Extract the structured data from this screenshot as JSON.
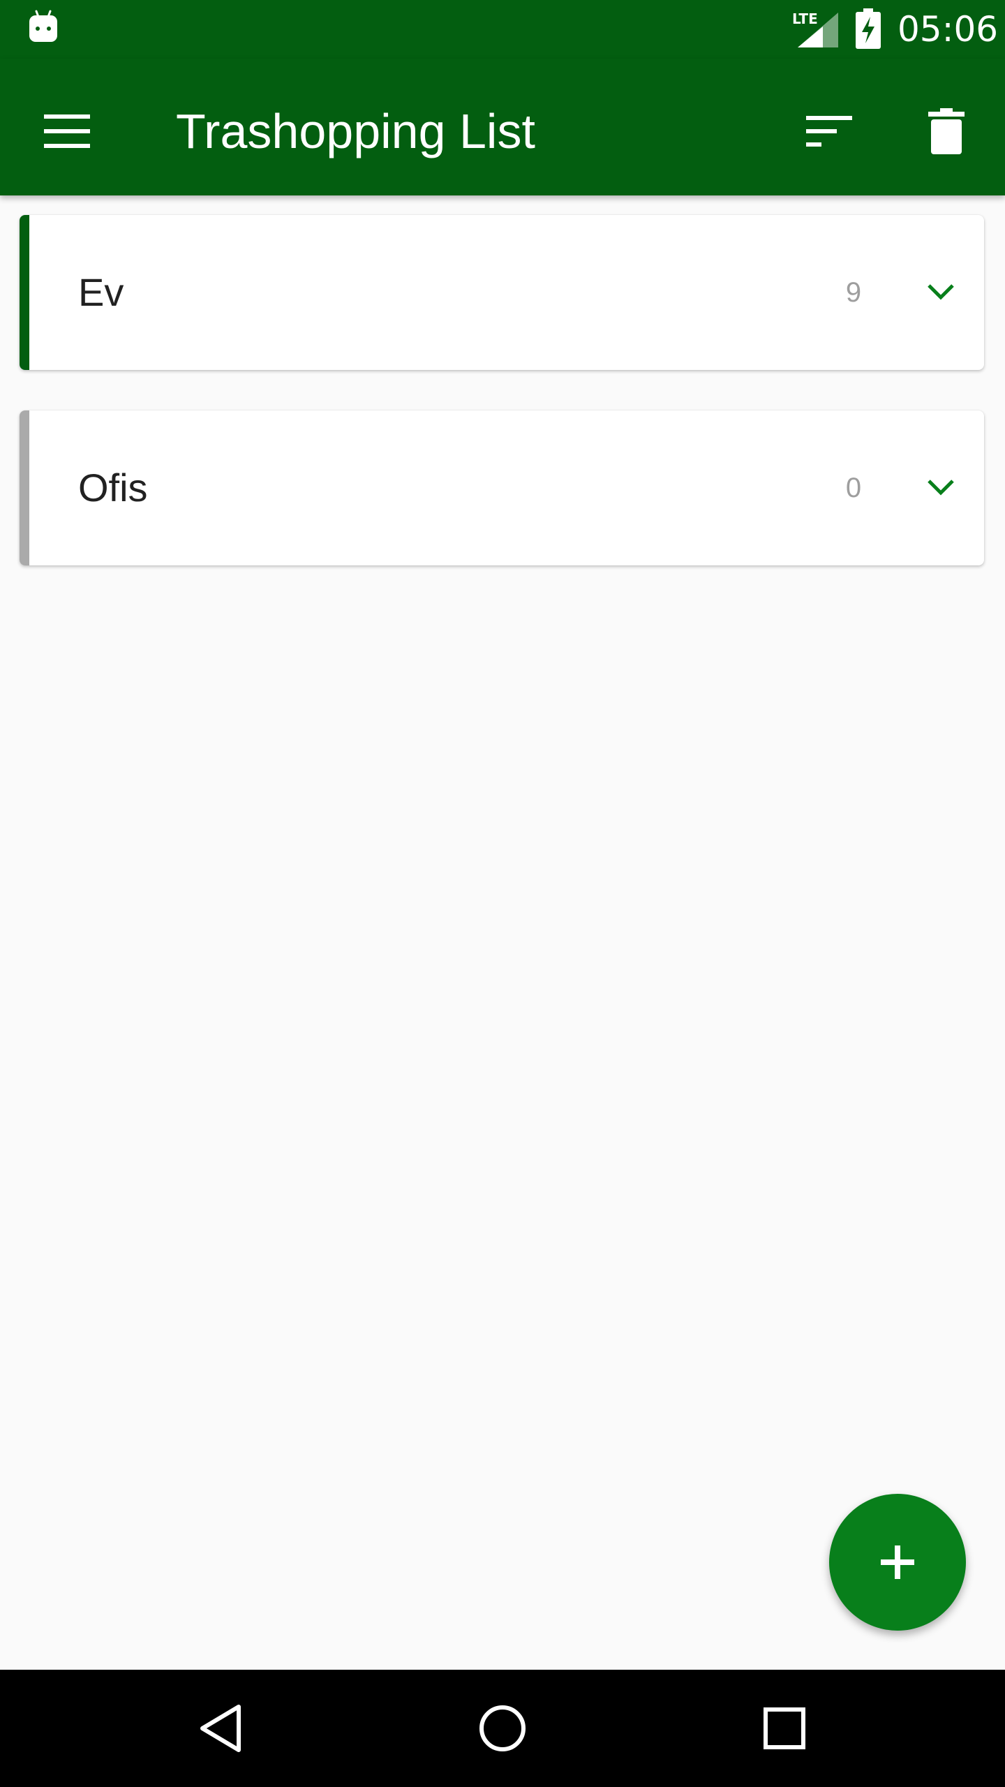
{
  "status_bar": {
    "time": "05:06",
    "network_label": "LTE",
    "icons": [
      "android-icon",
      "lte-signal-icon",
      "battery-charging-icon"
    ]
  },
  "app_bar": {
    "title": "Trashopping List",
    "icons": [
      "menu-icon",
      "sort-icon",
      "delete-icon"
    ]
  },
  "lists": [
    {
      "name": "Ev",
      "count": "9",
      "accent_color": "#035e10"
    },
    {
      "name": "Ofis",
      "count": "0",
      "accent_color": "#aaaaaa"
    }
  ],
  "colors": {
    "primary": "#035e10",
    "accent": "#087f1b",
    "background": "#fafafa"
  },
  "fab": {
    "icon": "add-icon"
  },
  "nav_bar": {
    "icons": [
      "back-icon",
      "home-icon",
      "recents-icon"
    ]
  }
}
